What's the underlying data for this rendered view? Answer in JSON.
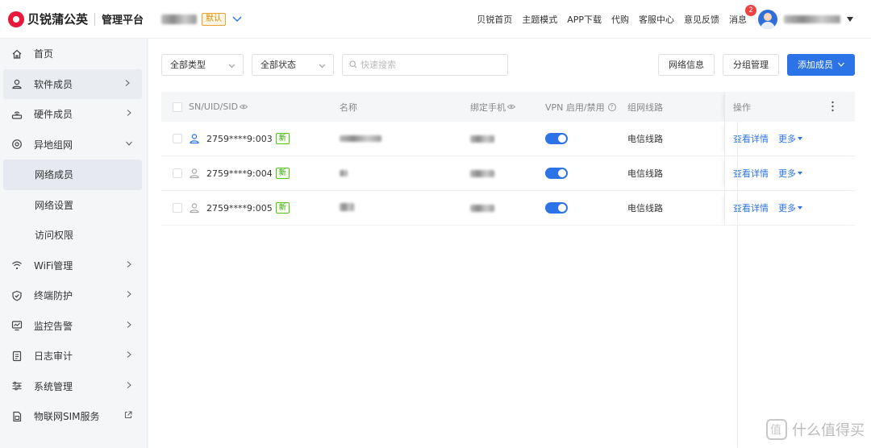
{
  "brand": {
    "name": "贝锐蒲公英",
    "subtitle": "管理平台"
  },
  "org": {
    "default_badge": "默认"
  },
  "topnav": {
    "links": [
      "贝锐首页",
      "主题模式",
      "APP下载",
      "代购",
      "客服中心",
      "意见反馈"
    ],
    "messages_label": "消息",
    "messages_count": "2"
  },
  "sidebar": {
    "items": [
      {
        "label": "首页",
        "icon": "home-icon"
      },
      {
        "label": "软件成员",
        "icon": "user-icon"
      },
      {
        "label": "硬件成员",
        "icon": "router-icon"
      },
      {
        "label": "异地组网",
        "icon": "network-icon"
      },
      {
        "label": "网络成员",
        "icon": ""
      },
      {
        "label": "网络设置",
        "icon": ""
      },
      {
        "label": "访问权限",
        "icon": ""
      },
      {
        "label": "WiFi管理",
        "icon": "wifi-icon"
      },
      {
        "label": "终端防护",
        "icon": "shield-icon"
      },
      {
        "label": "监控告警",
        "icon": "monitor-icon"
      },
      {
        "label": "日志审计",
        "icon": "log-icon"
      },
      {
        "label": "系统管理",
        "icon": "sliders-icon"
      },
      {
        "label": "物联网SIM服务",
        "icon": "sim-icon"
      }
    ]
  },
  "toolbar": {
    "type_select": "全部类型",
    "status_select": "全部状态",
    "search_placeholder": "快速搜索",
    "network_info": "网络信息",
    "group_manage": "分组管理",
    "add_member": "添加成员"
  },
  "table": {
    "headers": {
      "sn": "SN/UID/SID",
      "name": "名称",
      "phone": "绑定手机",
      "vpn": "VPN 启用/禁用",
      "line": "组网线路",
      "op": "操作"
    },
    "rows": [
      {
        "sn": "2759****9:003",
        "tag": "新",
        "line": "电信线路",
        "vpn_enabled": true,
        "online": true,
        "detail": "查看详情",
        "more": "更多"
      },
      {
        "sn": "2759****9:004",
        "tag": "新",
        "line": "电信线路",
        "vpn_enabled": true,
        "online": false,
        "detail": "查看详情",
        "more": "更多"
      },
      {
        "sn": "2759****9:005",
        "tag": "新",
        "line": "电信线路",
        "vpn_enabled": true,
        "online": false,
        "detail": "查看详情",
        "more": "更多"
      }
    ]
  },
  "watermark": {
    "text": "什么值得买"
  },
  "colors": {
    "primary": "#2b73e6",
    "brand": "#e8193b",
    "new_tag": "#52c41a",
    "badge": "#f04040"
  }
}
